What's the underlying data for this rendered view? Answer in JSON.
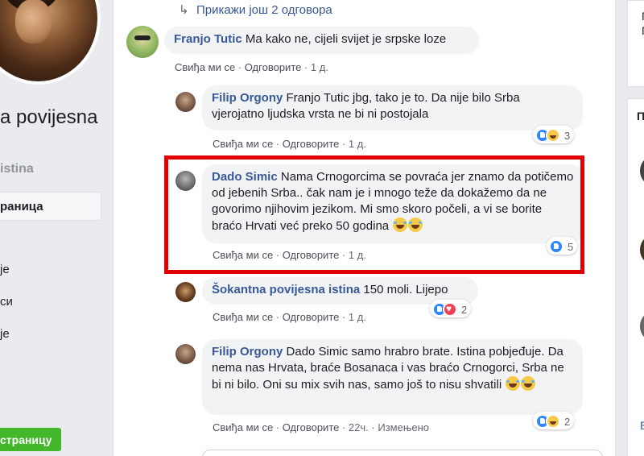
{
  "left": {
    "page_name": "a povijesna",
    "handle": "istina",
    "nav_active": "раница",
    "nav_items": [
      "је",
      "си",
      "је"
    ],
    "create_button": "страницу"
  },
  "more_replies": "Прикажи још 2 одговора",
  "comments": [
    {
      "author": "Franjo Tutic",
      "text": "Ma kako ne, cijeli svijet je srpske loze",
      "like": "Свиђа ми се",
      "reply": "Одговорите",
      "time": "1 д."
    },
    {
      "author": "Filip Orgony",
      "text": "Franjo Tutic jbg, tako je to. Da nije bilo Srba vjerojatno ljudska vrsta ne bi ni postojala",
      "like": "Свиђа ми се",
      "reply": "Одговорите",
      "time": "1 д.",
      "reactions": [
        "like",
        "haha"
      ],
      "reaction_count": "3"
    },
    {
      "author": "Dado Simic",
      "text": "Nama Crnogorcima se povraća jer znamo da potičemo od jebenih Srba.. čak nam je i mnogo teže da dokažemo da ne govorimo njihovim jezikom. Mi smo skoro počeli, a vi se borite braćo Hrvati već preko 50 godina",
      "like": "Свиђа ми се",
      "reply": "Одговорите",
      "time": "1 д.",
      "reactions": [
        "like"
      ],
      "reaction_count": "5"
    },
    {
      "author": "Šokantna povijesna istina",
      "text": "150 moli. Lijepo",
      "like": "Свиђа ми се",
      "reply": "Одговорите",
      "time": "1 д.",
      "reactions": [
        "like",
        "love"
      ],
      "reaction_count": "2"
    },
    {
      "author": "Filip Orgony",
      "text": "Dado Simic samo hrabro brate. Istina pobjeđuje. Da nema nas Hrvata, braće Bosanaca i vas braćo Crnogorci, Srba ne bi ni bilo. Oni su mix svih nas, samo još to nisu shvatili",
      "like": "Свиђа ми се",
      "reply": "Одговорите",
      "time": "22ч.",
      "edited": "Измењено",
      "reactions": [
        "like",
        "haha"
      ],
      "reaction_count": "2"
    }
  ],
  "right": {
    "letters": [
      "Г",
      "П",
      "П",
      "Е"
    ]
  },
  "colors": {
    "link": "#385898",
    "highlight": "#e00000",
    "create_button": "#42b72a",
    "bubble": "#f2f3f5"
  }
}
